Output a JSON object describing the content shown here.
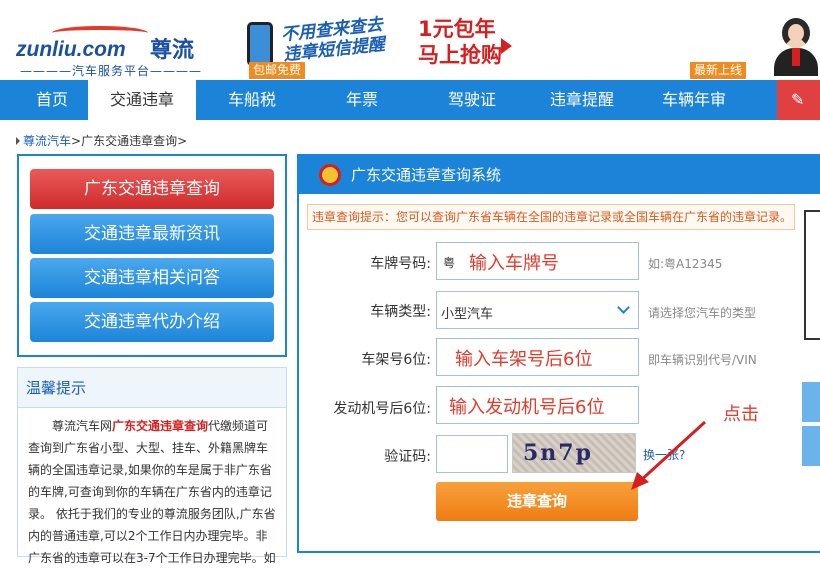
{
  "header": {
    "logo_en": "zunliu.com",
    "logo_cn": "尊流",
    "logo_sub": "————汽车服务平台————",
    "ad_lines": [
      "不用查来查去",
      "违章短信提醒"
    ],
    "ad_price": [
      "1元包年",
      "马上抢购"
    ],
    "tag_free": "包邮免费",
    "tag_new": "最新上线"
  },
  "nav": {
    "items": [
      "首页",
      "交通违章",
      "车船税",
      "年票",
      "驾驶证",
      "违章提醒",
      "车辆年审"
    ],
    "active": "交通违章",
    "red_item": "✎ 免"
  },
  "breadcrumb": {
    "home": "尊流汽车",
    "sep": ">",
    "current": "广东交通违章查询",
    "tail": ">"
  },
  "menu": {
    "items": [
      "广东交通违章查询",
      "交通违章最新资讯",
      "交通违章相关问答",
      "交通违章代办介绍"
    ]
  },
  "tips": {
    "title": "温馨提示",
    "body_pre": "尊流汽车网",
    "body_hl": "广东交通违章查询",
    "body_post": "代缴频道可查询到广东省小型、大型、挂车、外籍黑牌车辆的全国违章记录,如果你的车是属于非广东省的车牌,可查询到你的车辆在广东省内的违章记录。 依托于我们的专业的尊流服务团队,广东省内的普通违章,可以2个工作日内办理完毕。非广东省的违章可以在3-7个工作日办理完毕。如"
  },
  "panel": {
    "title": "广东交通违章查询系统",
    "notice": "违章查询提示：您可以查询广东省车辆在全国的违章记录或全国车辆在广东省的违章记录。",
    "plate_label": "车牌号码:",
    "plate_prefix": "粤",
    "plate_value": "输入车牌号",
    "plate_hint": "如:粤A12345",
    "type_label": "车辆类型:",
    "type_value": "小型汽车",
    "type_hint": "请选择您汽车的类型",
    "frame_label": "车架号6位:",
    "frame_value": "输入车架号后6位",
    "frame_hint": "即车辆识别代号/VIN",
    "engine_label": "发动机号后6位:",
    "engine_value": "输入发动机号后6位",
    "captcha_label": "验证码:",
    "captcha_value": "",
    "captcha_text": "5n7p",
    "refresh_label": "换一张?",
    "submit_label": "违章查询",
    "click_note": "点击"
  },
  "colors": {
    "nav_blue": "#1c84d8",
    "brand_red": "#e23b2b",
    "submit_orange": "#ef7c12",
    "notice_orange": "#d65a1f"
  }
}
